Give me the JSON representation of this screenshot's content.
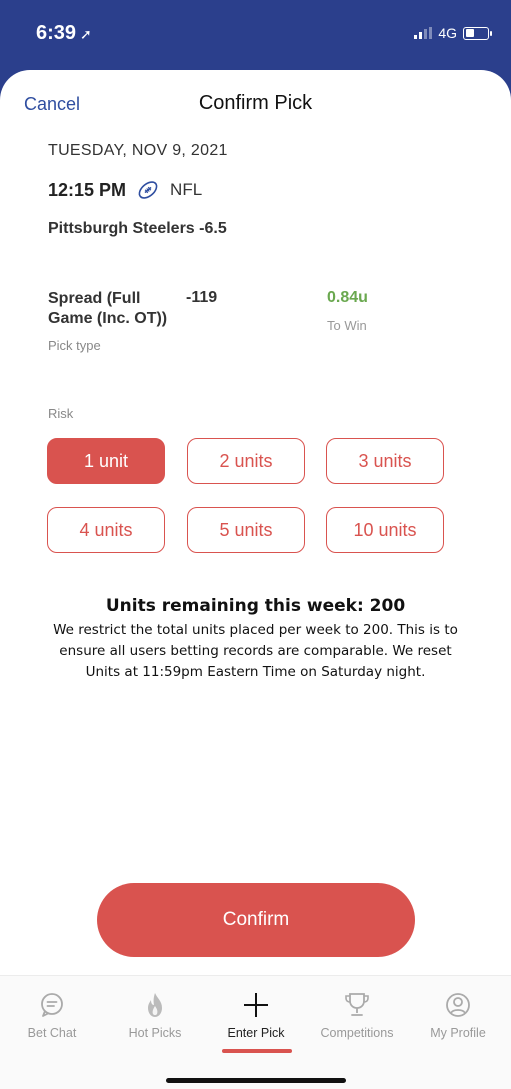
{
  "status_bar": {
    "time": "6:39",
    "network": "4G"
  },
  "header": {
    "cancel_label": "Cancel",
    "title": "Confirm Pick"
  },
  "game": {
    "date": "TUESDAY, NOV 9, 2021",
    "time": "12:15 PM",
    "league": "NFL",
    "league_icon": "football-icon",
    "team": "Pittsburgh Steelers -6.5"
  },
  "pick": {
    "type": "Spread (Full Game (Inc. OT))",
    "type_label": "Pick type",
    "odds": "-119",
    "to_win_value": "0.84u",
    "to_win_label": "To Win"
  },
  "risk": {
    "label": "Risk",
    "options": [
      "1 unit",
      "2 units",
      "3 units",
      "4 units",
      "5 units",
      "10 units"
    ],
    "selected": "1 unit"
  },
  "info": {
    "title": "Units remaining this week: 200",
    "body": "We restrict the total units placed per week to 200. This is to ensure all users betting records are comparable. We reset Units at 11:59pm Eastern Time on Saturday night."
  },
  "confirm_label": "Confirm",
  "tabs": [
    {
      "label": "Bet Chat",
      "icon": "chat-icon"
    },
    {
      "label": "Hot Picks",
      "icon": "fire-icon"
    },
    {
      "label": "Enter Pick",
      "icon": "plus-icon",
      "active": true
    },
    {
      "label": "Competitions",
      "icon": "trophy-icon"
    },
    {
      "label": "My Profile",
      "icon": "profile-icon"
    }
  ],
  "colors": {
    "brand_blue": "#2b3f8c",
    "accent_red": "#d9534f",
    "win_green": "#6aa84f"
  }
}
